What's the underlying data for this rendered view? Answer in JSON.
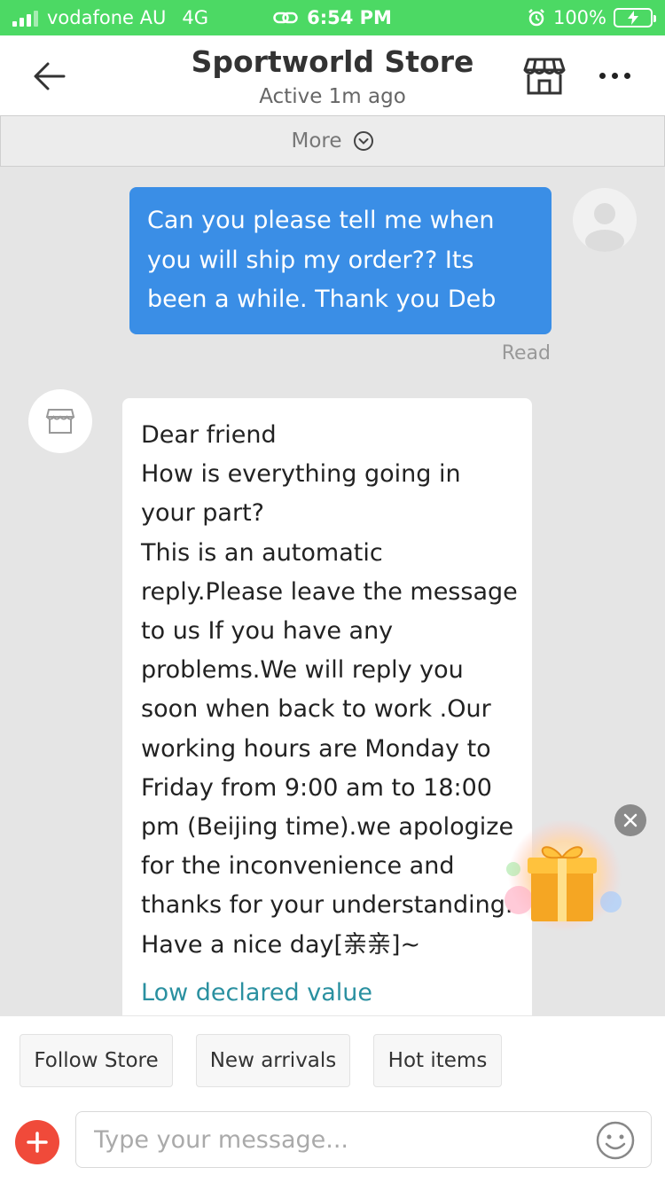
{
  "status_bar": {
    "carrier": "vodafone AU",
    "network": "4G",
    "time": "6:54 PM",
    "battery": "100%"
  },
  "header": {
    "title": "Sportworld Store",
    "subtitle": "Active 1m ago",
    "icons": [
      "back-arrow-icon",
      "store-icon",
      "more-dots-icon"
    ]
  },
  "more_bar": {
    "label": "More"
  },
  "messages": [
    {
      "direction": "outgoing",
      "text": "Can you please tell me when you will ship my order?? Its been a while. Thank you Deb",
      "status": "Read"
    },
    {
      "direction": "incoming",
      "text": "Dear friend\nHow is everything going in your part?\nThis is an automatic reply.Please leave the message to us If you have any problems.We will reply you soon when back to work .Our working hours are Monday to Friday from 9:00 am to 18:00 pm (Beijing time).we apologize for the inconvenience and thanks for your understanding.\nHave a nice day[亲亲]~",
      "link": "Low declared value"
    }
  ],
  "quick_replies": [
    "Follow Store",
    "New arrivals",
    "Hot items"
  ],
  "composer": {
    "placeholder": "Type your message..."
  },
  "colors": {
    "status_bar": "#4cd964",
    "outgoing_bubble": "#3a8ee6",
    "link": "#2a90a0",
    "add_button": "#f04a3a"
  }
}
